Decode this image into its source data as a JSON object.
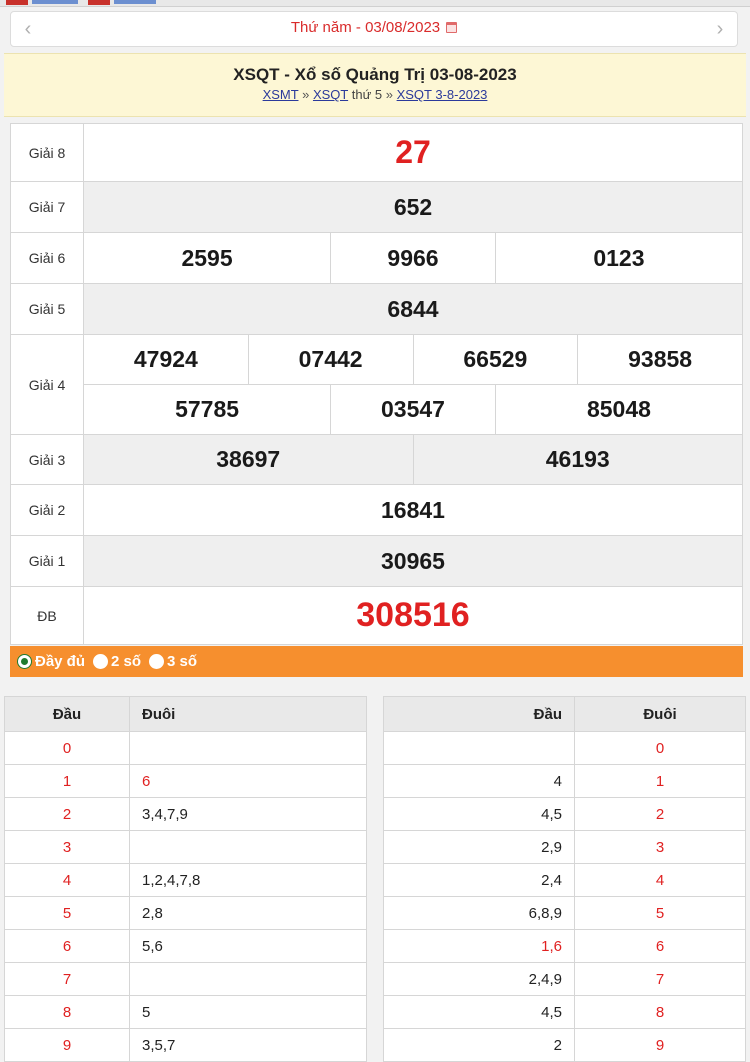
{
  "date_nav": {
    "prev_symbol": "‹",
    "next_symbol": "›",
    "label": "Thứ năm -  03/08/2023"
  },
  "header": {
    "title": "XSQT - Xổ số Quảng Trị 03-08-2023",
    "crumb_1": "XSMT",
    "crumb_sep_1": " » ",
    "crumb_2": "XSQT",
    "crumb_mid": " thứ 5",
    "crumb_sep_2": " » ",
    "crumb_3": "XSQT 3-8-2023"
  },
  "prizes": {
    "g8": {
      "label": "Giải 8",
      "numbers": [
        "27"
      ]
    },
    "g7": {
      "label": "Giải 7",
      "numbers": [
        "652"
      ]
    },
    "g6": {
      "label": "Giải 6",
      "numbers": [
        "2595",
        "9966",
        "0123"
      ]
    },
    "g5": {
      "label": "Giải 5",
      "numbers": [
        "6844"
      ]
    },
    "g4": {
      "label": "Giải 4",
      "row1": [
        "47924",
        "07442",
        "66529",
        "93858"
      ],
      "row2": [
        "57785",
        "03547",
        "85048"
      ]
    },
    "g3": {
      "label": "Giải 3",
      "numbers": [
        "38697",
        "46193"
      ]
    },
    "g2": {
      "label": "Giải 2",
      "numbers": [
        "16841"
      ]
    },
    "g1": {
      "label": "Giải 1",
      "numbers": [
        "30965"
      ]
    },
    "db": {
      "label": "ĐB",
      "numbers": [
        "308516"
      ]
    }
  },
  "options": [
    "Đầy đủ",
    "2 số",
    "3 số"
  ],
  "loto_left": {
    "headers": [
      "Đầu",
      "Đuôi"
    ],
    "rows": [
      [
        "0",
        ""
      ],
      [
        "1",
        "6"
      ],
      [
        "2",
        "3,4,7,9"
      ],
      [
        "3",
        ""
      ],
      [
        "4",
        "1,2,4,7,8"
      ],
      [
        "5",
        "2,8"
      ],
      [
        "6",
        "5,6"
      ],
      [
        "7",
        ""
      ],
      [
        "8",
        "5"
      ],
      [
        "9",
        "3,5,7"
      ]
    ]
  },
  "loto_right": {
    "headers": [
      "Đầu",
      "Đuôi"
    ],
    "rows": [
      [
        "",
        "0"
      ],
      [
        "4",
        "1"
      ],
      [
        "4,5",
        "2"
      ],
      [
        "2,9",
        "3"
      ],
      [
        "2,4",
        "4"
      ],
      [
        "6,8,9",
        "5"
      ],
      [
        "1,6",
        "6"
      ],
      [
        "2,4,9",
        "7"
      ],
      [
        "4,5",
        "8"
      ],
      [
        "2",
        "9"
      ]
    ]
  },
  "colors": {
    "accent_red": "#e02121",
    "options_bar": "#f68f2e",
    "title_bg": "#fdf7d5"
  }
}
